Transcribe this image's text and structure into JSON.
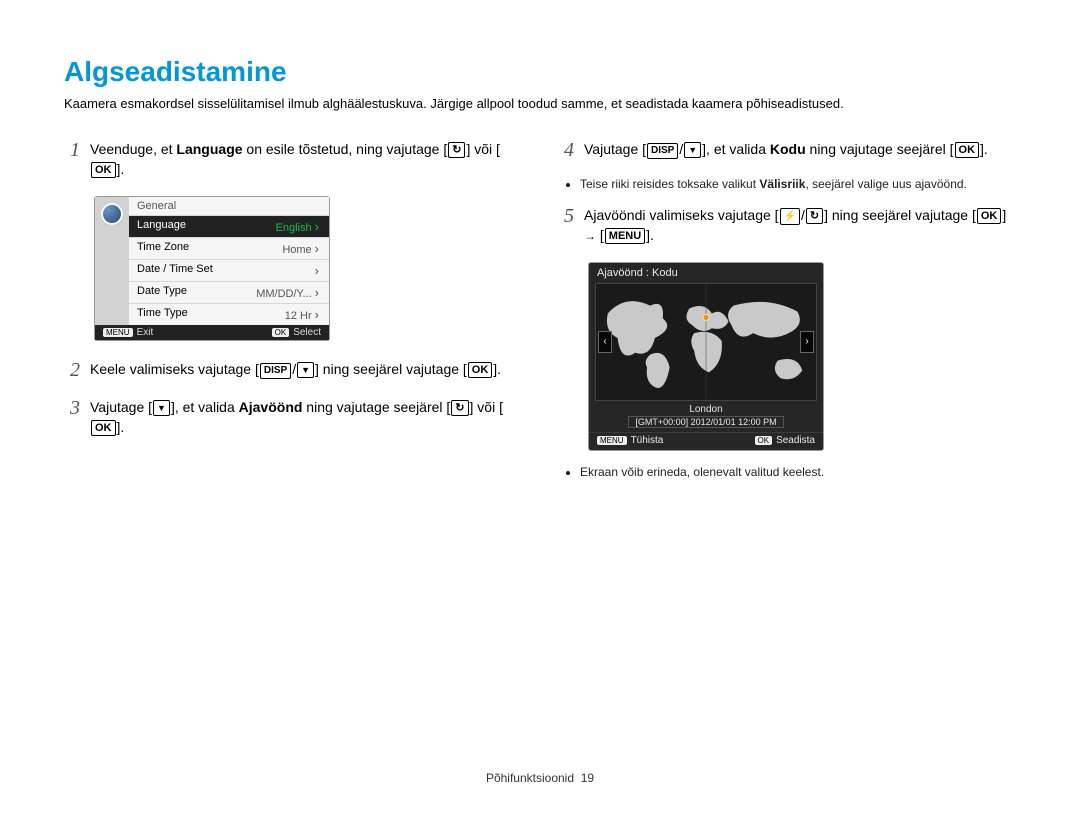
{
  "title": "Algseadistamine",
  "intro": "Kaamera esmakordsel sisselülitamisel ilmub alghäälestuskuva. Järgige allpool toodud samme, et seadistada kaamera põhiseadistused.",
  "steps": {
    "1": {
      "pre": "Veenduge, et ",
      "bold": "Language",
      "post": " on esile tõstetud, ning vajutage [",
      "btn1": "",
      "mid": "] või [",
      "btn2": "OK",
      "end": "]."
    },
    "2": {
      "pre": "Keele valimiseks vajutage [",
      "btn1": "DISP",
      "slash": "/",
      "btn2": "",
      "mid": "] ning seejärel vajutage [",
      "btn3": "OK",
      "end": "]."
    },
    "3": {
      "pre": "Vajutage [",
      "btn1": "",
      "mid1": "], et valida ",
      "bold": "Ajavöönd",
      "mid2": " ning vajutage seejärel [",
      "btn2": "",
      "mid3": "] või [",
      "btn3": "OK",
      "end": "]."
    },
    "4": {
      "pre": "Vajutage [",
      "btn1": "DISP",
      "slash": "/",
      "btn2": "",
      "mid1": "], et valida ",
      "bold": "Kodu",
      "mid2": " ning vajutage seejärel [",
      "btn3": "OK",
      "end": "]."
    },
    "5": {
      "pre": "Ajavööndi valimiseks vajutage [",
      "btn1": "",
      "slash": "/",
      "btn2": "",
      "mid": "] ning seejärel vajutage [",
      "btn3": "OK",
      "mid2": "] ",
      "arrow": "→",
      "mid3": " [",
      "btn4": "MENU",
      "end": "]."
    }
  },
  "notes": {
    "foreign": {
      "pre": "Teise riiki reisides toksake valikut ",
      "bold": "Välisriik",
      "post": ", seejärel valige uus ajavöönd."
    },
    "screen": "Ekraan võib erineda, olenevalt valitud keelest."
  },
  "lcd_general": {
    "header": "General",
    "rows": [
      {
        "label": "Language",
        "value": "English",
        "chev": true,
        "selected": true
      },
      {
        "label": "Time Zone",
        "value": "Home",
        "chev": true,
        "selected": false
      },
      {
        "label": "Date / Time Set",
        "value": "",
        "chev": true,
        "selected": false
      },
      {
        "label": "Date Type",
        "value": "MM/DD/Y...",
        "chev": true,
        "selected": false
      },
      {
        "label": "Time Type",
        "value": "12 Hr",
        "chev": true,
        "selected": false
      }
    ],
    "foot_left_key": "MENU",
    "foot_left_label": "Exit",
    "foot_right_key": "OK",
    "foot_right_label": "Select"
  },
  "lcd_timezone": {
    "title": "Ajavöönd : Kodu",
    "nav_left": "‹",
    "nav_right": "›",
    "city": "London",
    "gmt": "[GMT+00:00] 2012/01/01 12:00 PM",
    "foot_left_key": "MENU",
    "foot_left_label": "Tühista",
    "foot_right_key": "OK",
    "foot_right_label": "Seadista"
  },
  "footer": {
    "section": "Põhifunktsioonid",
    "page": "19"
  }
}
